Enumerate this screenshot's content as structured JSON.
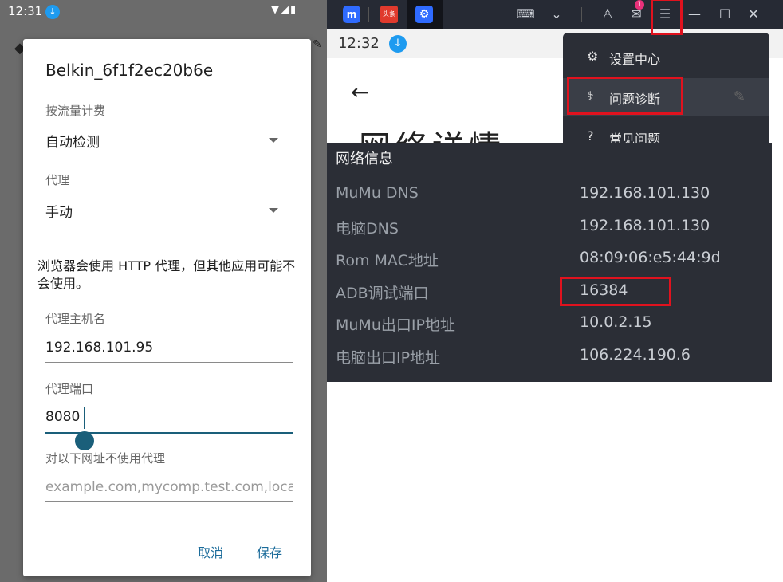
{
  "left_panel": {
    "status_time": "12:31",
    "dialog": {
      "title": "Belkin_6f1f2ec20b6e",
      "metered_label": "按流量计费",
      "metered_value": "自动检测",
      "proxy_label": "代理",
      "proxy_value": "手动",
      "note": "浏览器会使用 HTTP 代理，但其他应用可能不会使用。",
      "hostname_label": "代理主机名",
      "hostname_value": "192.168.101.95",
      "port_label": "代理端口",
      "port_value": "8080",
      "bypass_label": "对以下网址不使用代理",
      "bypass_placeholder": "example.com,mycomp.test.com,localhost",
      "cancel_label": "取消",
      "save_label": "保存"
    }
  },
  "right_panel": {
    "mail_badge_count": "1",
    "app_news_label": "头条",
    "status_time": "12:32",
    "page_heading": "网络详情",
    "menu": {
      "items": [
        {
          "label": "设置中心",
          "icon": "gear-icon"
        },
        {
          "label": "问题诊断",
          "icon": "stethoscope-icon"
        },
        {
          "label": "常见问题",
          "icon": "help-circle-icon"
        }
      ]
    },
    "network_info": {
      "title": "网络信息",
      "rows": [
        {
          "key": "MuMu DNS",
          "value": "192.168.101.130"
        },
        {
          "key": "电脑DNS",
          "value": "192.168.101.130"
        },
        {
          "key": "Rom MAC地址",
          "value": "08:09:06:e5:44:9d"
        },
        {
          "key": "ADB调试端口",
          "value": "16384"
        },
        {
          "key": "MuMu出口IP地址",
          "value": "10.0.2.15"
        },
        {
          "key": "电脑出口IP地址",
          "value": "106.224.190.6"
        }
      ]
    }
  },
  "colors": {
    "highlight": "#e0121e",
    "accent_teal": "#1a5f7a",
    "titlebar": "#262a34",
    "panel": "#2b2e36"
  }
}
